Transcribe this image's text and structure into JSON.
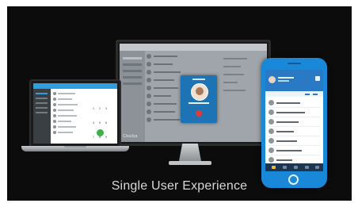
{
  "caption": "Single User Experience",
  "desktop_app": {
    "logo": "Cloudya"
  },
  "laptop_app": {
    "logo": "Cloudya",
    "dialpad": [
      "1",
      "2",
      "3",
      "4",
      "5",
      "6",
      "7",
      "8",
      "9",
      "*",
      "0",
      "#"
    ]
  },
  "colors": {
    "background": "#0c0c0c",
    "caption": "#d8d8d8",
    "brand_blue": "#1a88d8",
    "call_green": "#3cb24a",
    "end_call_red": "#e53935"
  }
}
